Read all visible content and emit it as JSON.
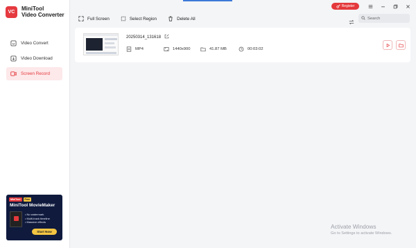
{
  "app": {
    "logo_abbrev": "VC",
    "name_line1": "MiniTool",
    "name_line2": "Video Converter"
  },
  "sidebar": {
    "items": [
      {
        "label": "Video Convert",
        "icon": "video-convert-icon"
      },
      {
        "label": "Video Download",
        "icon": "download-icon"
      },
      {
        "label": "Screen Record",
        "icon": "record-icon",
        "active": true
      }
    ]
  },
  "ad": {
    "badge_brand": "MiniTool",
    "badge_free": "Free",
    "title": "MiniTool MovieMaker",
    "features": [
      "No watermark",
      "Multi-track timeline",
      "Massive effects"
    ],
    "button": "Start Now"
  },
  "titlebar": {
    "register_label": "Register"
  },
  "toolbar": {
    "full_screen": "Full Screen",
    "select_region": "Select Region",
    "delete_all": "Delete All"
  },
  "search": {
    "placeholder": "Search"
  },
  "recording": {
    "file_name": "20250314_131618",
    "format": "MP4",
    "resolution": "1440x900",
    "size": "41.87 MB",
    "duration": "00:03:02"
  },
  "watermark": {
    "line1": "Activate Windows",
    "line2": "Go to Settings to activate Windows."
  },
  "colors": {
    "accent": "#e4393c",
    "active_bg": "#fde8ea",
    "background": "#f4f5f7"
  }
}
